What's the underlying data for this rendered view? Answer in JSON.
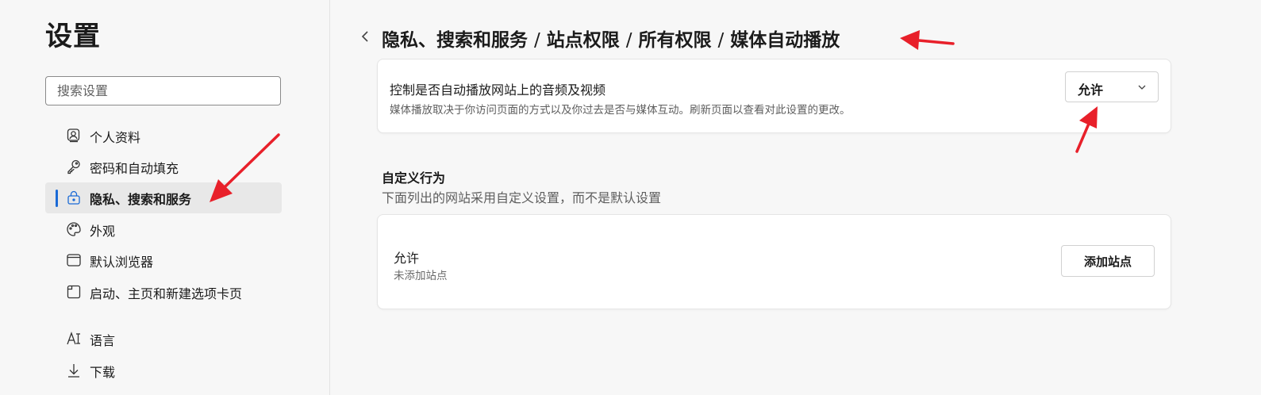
{
  "sidebar": {
    "title": "设置",
    "search_placeholder": "搜索设置",
    "items": [
      {
        "label": "个人资料",
        "icon": "profile-icon"
      },
      {
        "label": "密码和自动填充",
        "icon": "key-icon"
      },
      {
        "label": "隐私、搜索和服务",
        "icon": "lock-icon",
        "active": true
      },
      {
        "label": "外观",
        "icon": "palette-icon"
      },
      {
        "label": "默认浏览器",
        "icon": "browser-icon"
      },
      {
        "label": "启动、主页和新建选项卡页",
        "icon": "newtab-icon"
      },
      {
        "label": "语言",
        "icon": "language-icon"
      },
      {
        "label": "下载",
        "icon": "download-icon"
      }
    ]
  },
  "header": {
    "breadcrumb": [
      "隐私、搜索和服务",
      "站点权限",
      "所有权限",
      "媒体自动播放"
    ],
    "separator": "/"
  },
  "autoplay_card": {
    "title": "控制是否自动播放网站上的音频及视频",
    "description": "媒体播放取决于你访问页面的方式以及你过去是否与媒体互动。刷新页面以查看对此设置的更改。",
    "selected_option": "允许"
  },
  "custom_section": {
    "title": "自定义行为",
    "description": "下面列出的网站采用自定义设置，而不是默认设置"
  },
  "allow_card": {
    "title": "允许",
    "empty_text": "未添加站点",
    "add_button": "添加站点"
  },
  "colors": {
    "accent": "#1a6ad6",
    "annotation_arrow": "#e8202a"
  }
}
